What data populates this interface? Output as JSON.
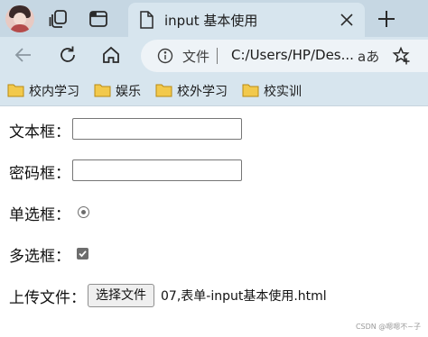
{
  "browser": {
    "tab": {
      "title": "input 基本使用"
    },
    "address": {
      "label": "文件",
      "url": "C:/Users/HP/Des...",
      "read_aloud": "aあ"
    },
    "bookmarks": [
      {
        "label": "校内学习"
      },
      {
        "label": "娱乐"
      },
      {
        "label": "校外学习"
      },
      {
        "label": "校实训"
      }
    ],
    "colors": {
      "chrome": "#c6d7e3",
      "toolbar": "#d7e5ee",
      "folder": "#f2c94c"
    }
  },
  "form": {
    "text_label": "文本框：",
    "text_value": "",
    "password_label": "密码框：",
    "password_value": "",
    "radio_label": "单选框：",
    "radio_checked": true,
    "checkbox_label": "多选框：",
    "checkbox_checked": true,
    "file_label": "上传文件：",
    "file_button": "选择文件",
    "file_name": "07,表单-input基本使用.html"
  },
  "watermark": "CSDN @嗯嗯不~子"
}
